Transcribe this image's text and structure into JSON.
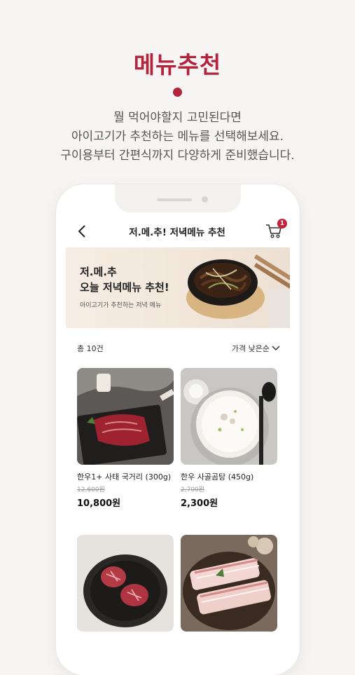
{
  "promo": {
    "headline": "메뉴추천",
    "lines": [
      "뭘 먹어야할지 고민된다면",
      "아이고기가 추천하는 메뉴를 선택해보세요.",
      "구이용부터 간편식까지 다양하게 준비했습니다."
    ]
  },
  "navbar": {
    "title": "저.메.추! 저녁메뉴 추천",
    "cart_count": "1"
  },
  "banner": {
    "title_line1": "저.메.추",
    "title_line2": "오늘 저녁메뉴 추천!",
    "subtitle": "아이고기가 추천하는 저녁 메뉴"
  },
  "list": {
    "count": "총 10건",
    "sort": "가격 낮은순"
  },
  "products": [
    {
      "name": "한우1+ 사태 국거리 (300g)",
      "original_price": "12,600원",
      "price": "10,800원"
    },
    {
      "name": "한우 사골곰탕 (450g)",
      "original_price": "2,700원",
      "price": "2,300원"
    }
  ],
  "colors": {
    "brand": "#b3233b",
    "badge": "#c4213a"
  }
}
